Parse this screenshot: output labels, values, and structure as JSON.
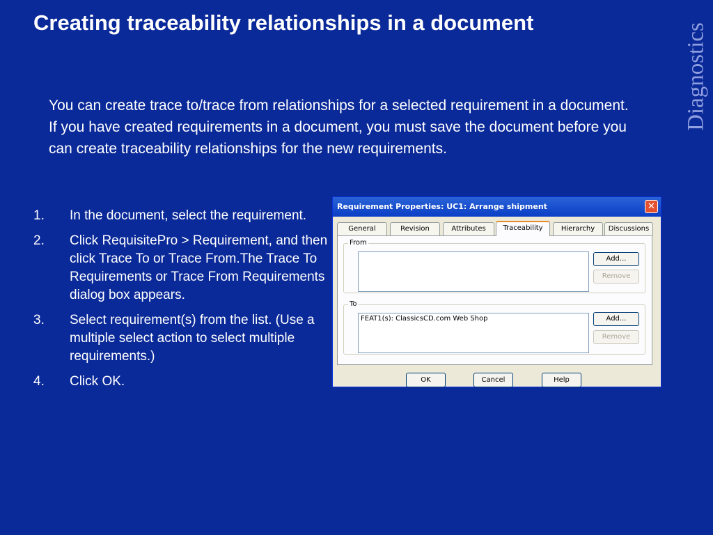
{
  "slide": {
    "title": "Creating traceability relationships in a document",
    "side_label": "Diagnostics",
    "intro": "You can create trace to/trace from relationships for a selected requirement in a document. If you have created requirements in a document, you must save the document before you can create traceability relationships for the new requirements.",
    "steps": [
      {
        "num": "1.",
        "text": "In the document, select the requirement."
      },
      {
        "num": "2.",
        "text": "Click RequisitePro > Requirement, and then click Trace To or Trace From.The Trace To Requirements or Trace From Requirements dialog box appears."
      },
      {
        "num": "3.",
        "text": "Select requirement(s) from the list. (Use a multiple select action to select multiple requirements.)"
      },
      {
        "num": "4.",
        "text": "Click OK."
      }
    ]
  },
  "dialog": {
    "title": "Requirement Properties: UC1: Arrange shipment",
    "close": "✕",
    "tabs": [
      "General",
      "Revision",
      "Attributes",
      "Traceability",
      "Hierarchy",
      "Discussions"
    ],
    "active_tab": "Traceability",
    "from_group": {
      "label": "From",
      "items": [],
      "add": "Add...",
      "remove": "Remove"
    },
    "to_group": {
      "label": "To",
      "items": [
        "FEAT1(s): ClassicsCD.com Web Shop"
      ],
      "add": "Add...",
      "remove": "Remove"
    },
    "buttons": {
      "ok": "OK",
      "cancel": "Cancel",
      "help": "Help"
    }
  },
  "colors": {
    "background": "#0b2a99",
    "side_label": "#8f9fe0",
    "titlebar": "#0a3ec5"
  }
}
